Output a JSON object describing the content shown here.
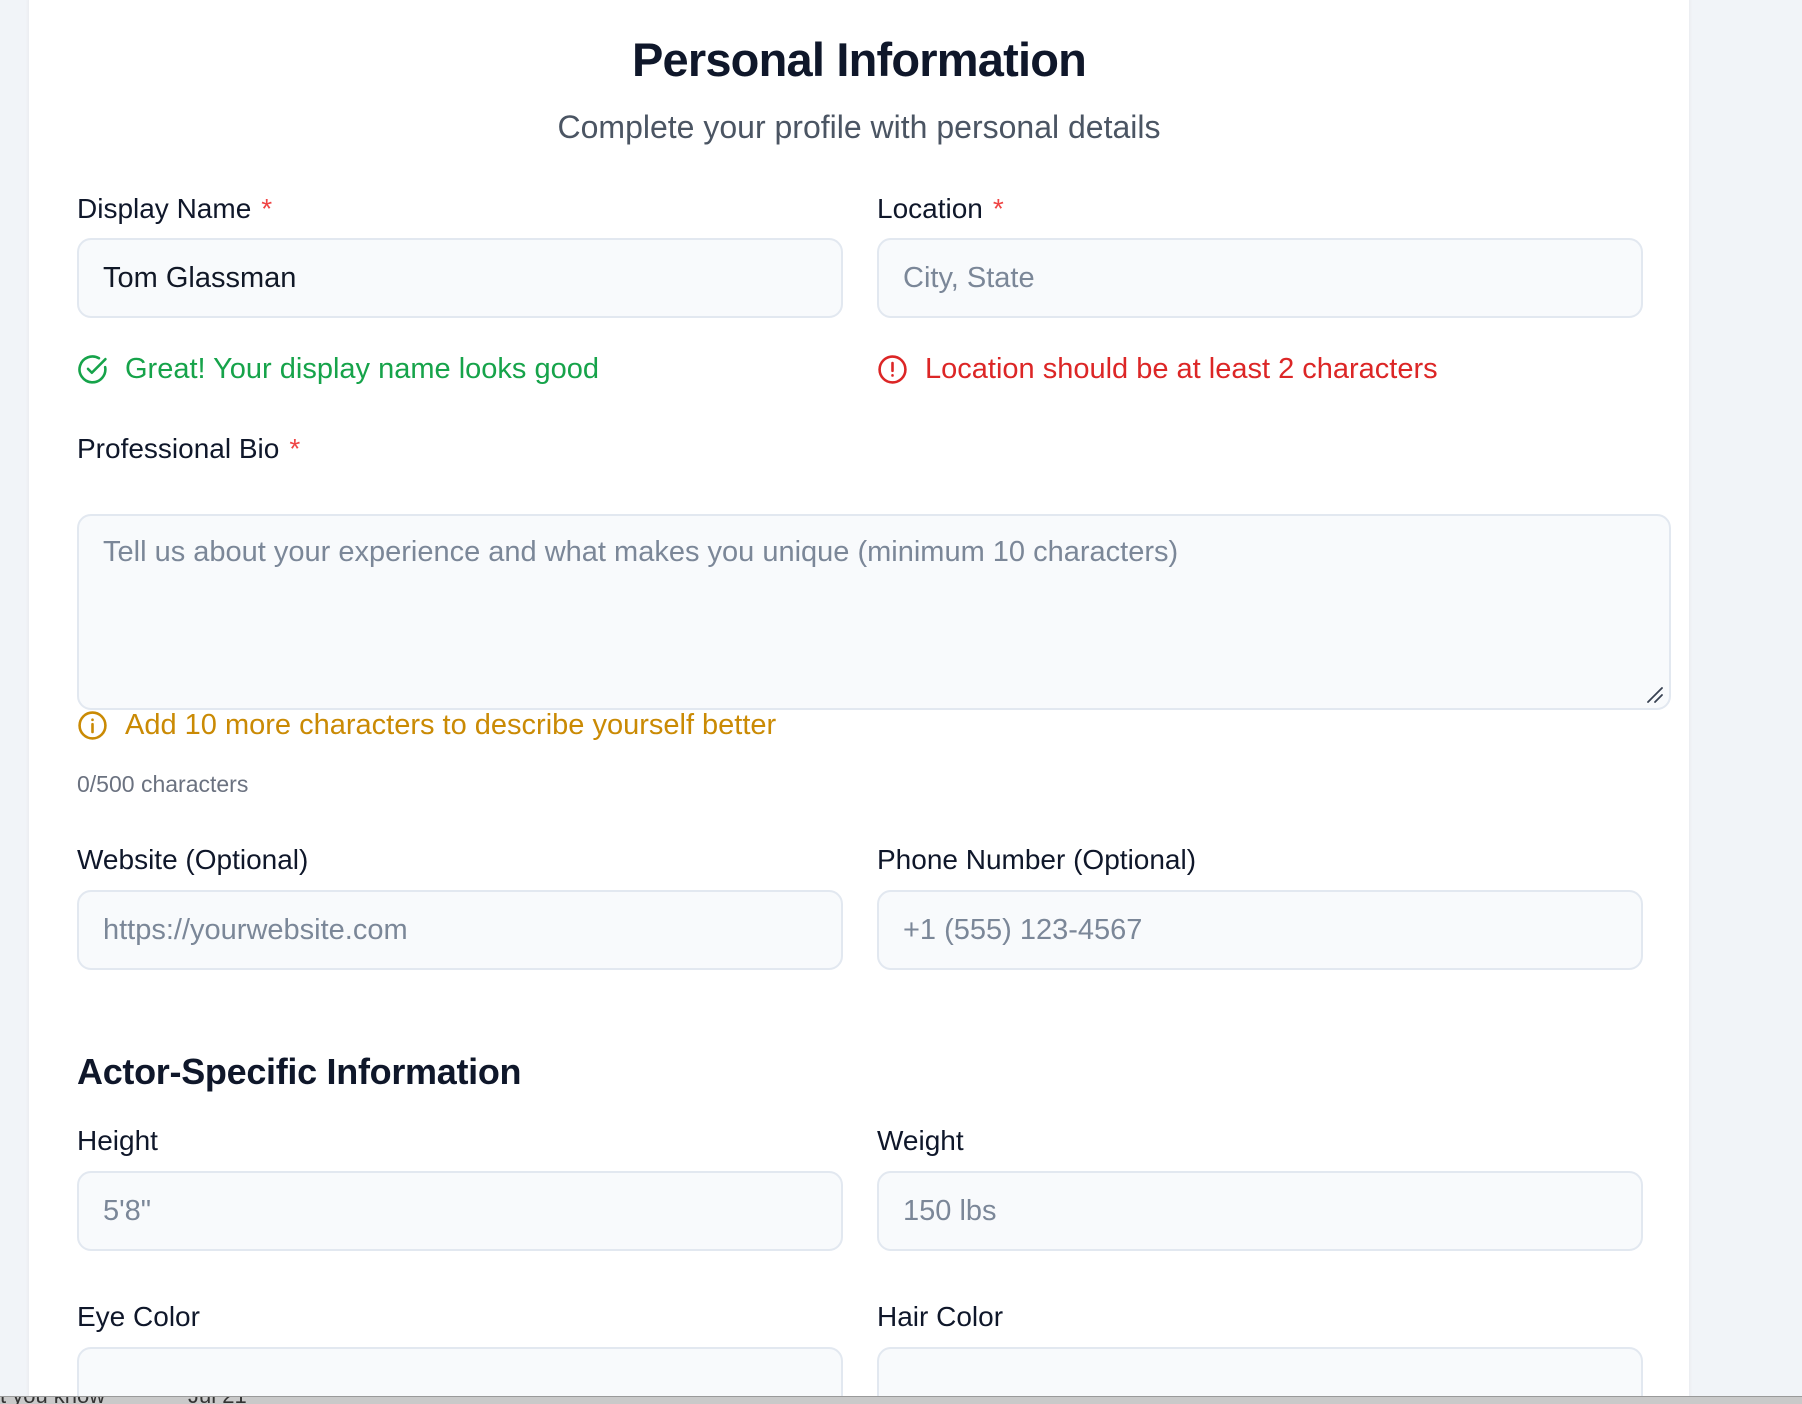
{
  "header": {
    "title": "Personal Information",
    "subtitle": "Complete your profile with personal details"
  },
  "fields": {
    "display_name": {
      "label": "Display Name",
      "required_mark": "*",
      "value": "Tom Glassman",
      "placeholder": ""
    },
    "location": {
      "label": "Location",
      "required_mark": "*",
      "value": "",
      "placeholder": "City, State"
    },
    "bio": {
      "label": "Professional Bio",
      "required_mark": "*",
      "value": "",
      "placeholder": "Tell us about your experience and what makes you unique (minimum 10 characters)"
    },
    "website": {
      "label": "Website (Optional)",
      "value": "",
      "placeholder": "https://yourwebsite.com"
    },
    "phone": {
      "label": "Phone Number (Optional)",
      "value": "",
      "placeholder": "+1 (555) 123-4567"
    },
    "height": {
      "label": "Height",
      "value": "",
      "placeholder": "5'8\""
    },
    "weight": {
      "label": "Weight",
      "value": "",
      "placeholder": "150 lbs"
    },
    "eye_color": {
      "label": "Eye Color"
    },
    "hair_color": {
      "label": "Hair Color"
    }
  },
  "messages": {
    "display_name_success": "Great! Your display name looks good",
    "location_error": "Location should be at least 2 characters",
    "bio_hint": "Add 10 more characters to describe yourself better",
    "bio_counter": "0/500 characters"
  },
  "sections": {
    "actor_title": "Actor-Specific Information"
  },
  "icons": {
    "success": "check-circle-icon",
    "error": "alert-circle-icon",
    "info": "info-circle-icon"
  },
  "colors": {
    "success": "#16a34a",
    "error": "#dc2626",
    "warning": "#ca8a04",
    "required": "#ef4444"
  },
  "taskbar": {
    "text_left": "t you know",
    "text_date": "Jul 21"
  }
}
